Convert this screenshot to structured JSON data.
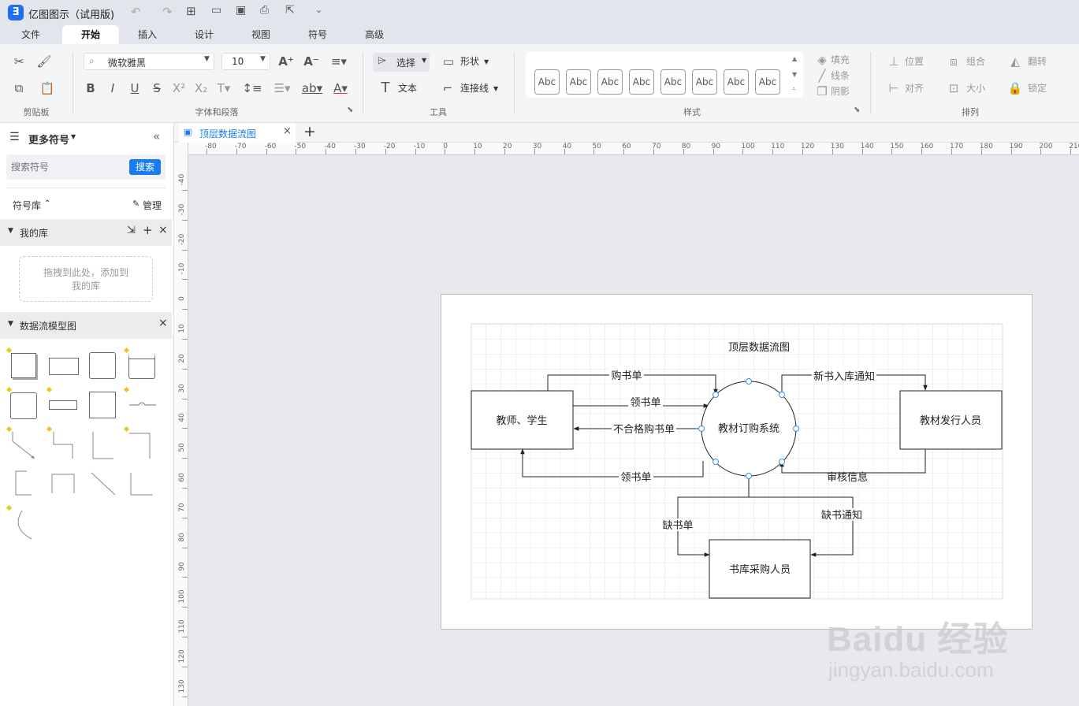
{
  "app": {
    "title": "亿图图示（试用版)"
  },
  "menu": {
    "tabs": [
      "文件",
      "开始",
      "插入",
      "设计",
      "视图",
      "符号",
      "高级"
    ]
  },
  "ribbon": {
    "groups": {
      "clipboard": "剪贴板",
      "font": "字体和段落",
      "tools": "工具",
      "styles": "样式",
      "arrange": "排列"
    },
    "font_name": "微软雅黑",
    "font_size": "10",
    "select_label": "选择",
    "shape_label": "形状",
    "text_label": "文本",
    "connector_label": "连接线",
    "style_sample": "Abc",
    "fill_label": "填充",
    "line_label": "线条",
    "shadow_label": "阴影",
    "position_label": "位置",
    "group_label": "组合",
    "flip_label": "翻转",
    "align_label": "对齐",
    "size_label": "大小",
    "lock_label": "锁定"
  },
  "sidebar": {
    "title": "更多符号",
    "search_placeholder": "搜索符号",
    "search_button": "搜索",
    "library_label": "符号库",
    "manage_label": "管理",
    "my_library": "我的库",
    "drop_hint": "拖拽到此处，添加到我的库",
    "dfd_library": "数据流模型图"
  },
  "document": {
    "tab_name": "顶层数据流图"
  },
  "rulers": {
    "horizontal": [
      "-80",
      "-70",
      "-60",
      "-50",
      "-40",
      "-30",
      "-20",
      "-10",
      "0",
      "10",
      "20",
      "30",
      "40",
      "50",
      "60",
      "70",
      "80",
      "90",
      "100",
      "110",
      "120",
      "130",
      "140",
      "150",
      "160",
      "170",
      "180",
      "190",
      "200",
      "210"
    ],
    "vertical": [
      "-40",
      "-30",
      "-20",
      "-10",
      "0",
      "10",
      "20",
      "30",
      "40",
      "50",
      "60",
      "70",
      "80",
      "90",
      "100",
      "110",
      "120",
      "130"
    ]
  },
  "diagram": {
    "title": "顶层数据流图",
    "process": "教材订购系统",
    "entities": {
      "teacher": "教师、学生",
      "publisher": "教材发行人员",
      "purchaser": "书库采购人员"
    },
    "flows": {
      "purchase_order": "购书单",
      "collect_order_top": "领书单",
      "rejected_order": "不合格购书单",
      "collect_order_bottom": "领书单",
      "new_stock_notice": "新书入库通知",
      "audit_info": "审核信息",
      "shortage_list": "缺书单",
      "shortage_notice": "缺书通知"
    }
  },
  "watermark": {
    "brand": "Baidu 经验",
    "url": "jingyan.baidu.com"
  }
}
